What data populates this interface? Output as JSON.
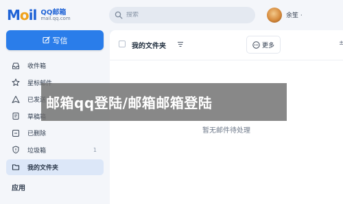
{
  "header": {
    "logo_word": "M il",
    "logo_name": "QQ邮箱",
    "logo_domain": "mail.qq.com",
    "search_placeholder": "搜索",
    "username": "余笙 ·"
  },
  "sidebar": {
    "compose_label": "写信",
    "items": [
      {
        "label": "收件箱",
        "icon": "inbox-icon",
        "count": ""
      },
      {
        "label": "星标邮件",
        "icon": "star-icon",
        "count": ""
      },
      {
        "label": "已发送",
        "icon": "send-icon",
        "count": ""
      },
      {
        "label": "草稿箱",
        "icon": "draft-icon",
        "count": ""
      },
      {
        "label": "已删除",
        "icon": "trash-icon",
        "count": ""
      },
      {
        "label": "垃圾箱",
        "icon": "spam-shield-icon",
        "count": "1"
      },
      {
        "label": "我的文件夹",
        "icon": "folder-icon",
        "count": ""
      }
    ],
    "apps_title": "应用"
  },
  "main": {
    "folder_title": "我的文件夹",
    "more_label": "更多",
    "extra_glyph": "±",
    "empty_message": "暂无邮件待处理"
  },
  "overlay": {
    "banner_text": "邮箱qq登陆/邮箱邮箱登陆"
  },
  "colors": {
    "accent": "#2a7dea",
    "logo_blue": "#1f63d6",
    "logo_orange": "#f0a21c",
    "active_bg": "#dce7f8"
  }
}
